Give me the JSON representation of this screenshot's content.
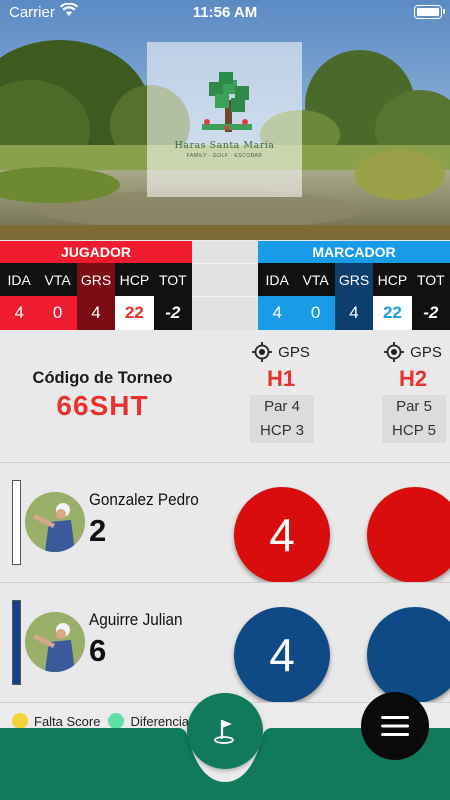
{
  "status_bar": {
    "carrier": "Carrier",
    "time": "11:56 AM"
  },
  "hero": {
    "logo_name": "Haras Santa María",
    "logo_tagline": "FAMILY · GOLF · ESCOBAR"
  },
  "jugador": {
    "title": "JUGADOR",
    "labels": [
      "IDA",
      "VTA",
      "GRS",
      "HCP",
      "TOT"
    ],
    "values": [
      "4",
      "0",
      "4",
      "22",
      "-2"
    ]
  },
  "marcador": {
    "title": "MARCADOR",
    "labels": [
      "IDA",
      "VTA",
      "GRS",
      "HCP",
      "TOT"
    ],
    "values": [
      "4",
      "0",
      "4",
      "22",
      "-2"
    ]
  },
  "tournament": {
    "label": "Código de Torneo",
    "code": "66SHT"
  },
  "holes": [
    {
      "gps": "GPS",
      "name": "H1",
      "par": "Par 4",
      "hcp": "HCP 3"
    },
    {
      "gps": "GPS",
      "name": "H2",
      "par": "Par 5",
      "hcp": "HCP 5"
    }
  ],
  "players": [
    {
      "name": "Gonzalez Pedro",
      "hcp": "2",
      "score_h1": "4",
      "score_h2": "",
      "color": "#d90d0d",
      "bar_color": "#ffffff"
    },
    {
      "name": "Aguirre Julian",
      "hcp": "6",
      "score_h1": "4",
      "score_h2": "",
      "color": "#0f4a87",
      "bar_color": "#14428a"
    }
  ],
  "legend": [
    {
      "label": "Falta Score",
      "color": "#f5d33b"
    },
    {
      "label": "Diferencia",
      "color": "#5ee0a7"
    }
  ],
  "colors": {
    "red": "#ee1c2e",
    "blue": "#1a9be8",
    "green": "#117a5c"
  },
  "icons": {
    "gps": "gps-target-icon",
    "flag": "golf-flag-icon",
    "menu": "hamburger-menu-icon"
  }
}
